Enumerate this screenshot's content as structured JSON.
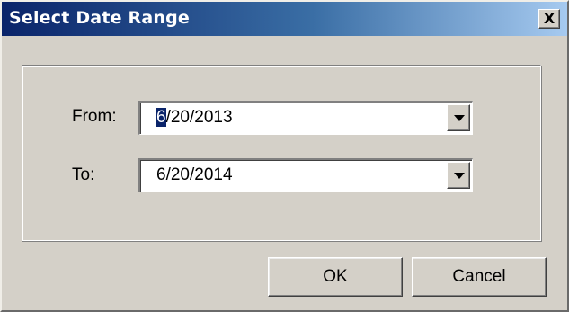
{
  "window": {
    "title": "Select Date Range",
    "close_label": "X"
  },
  "form": {
    "from_label": "From:",
    "from_value_first": "6",
    "from_value_rest": "/20/2013",
    "to_label": "To:",
    "to_value": "6/20/2014"
  },
  "buttons": {
    "ok_label": "OK",
    "cancel_label": "Cancel"
  },
  "icons": {
    "close": "close-icon",
    "dropdown": "chevron-down-icon"
  },
  "colors": {
    "titlebar_start": "#0a246a",
    "titlebar_end": "#a6caf0",
    "dialog_face": "#d4d0c8",
    "selection": "#0a246a"
  }
}
